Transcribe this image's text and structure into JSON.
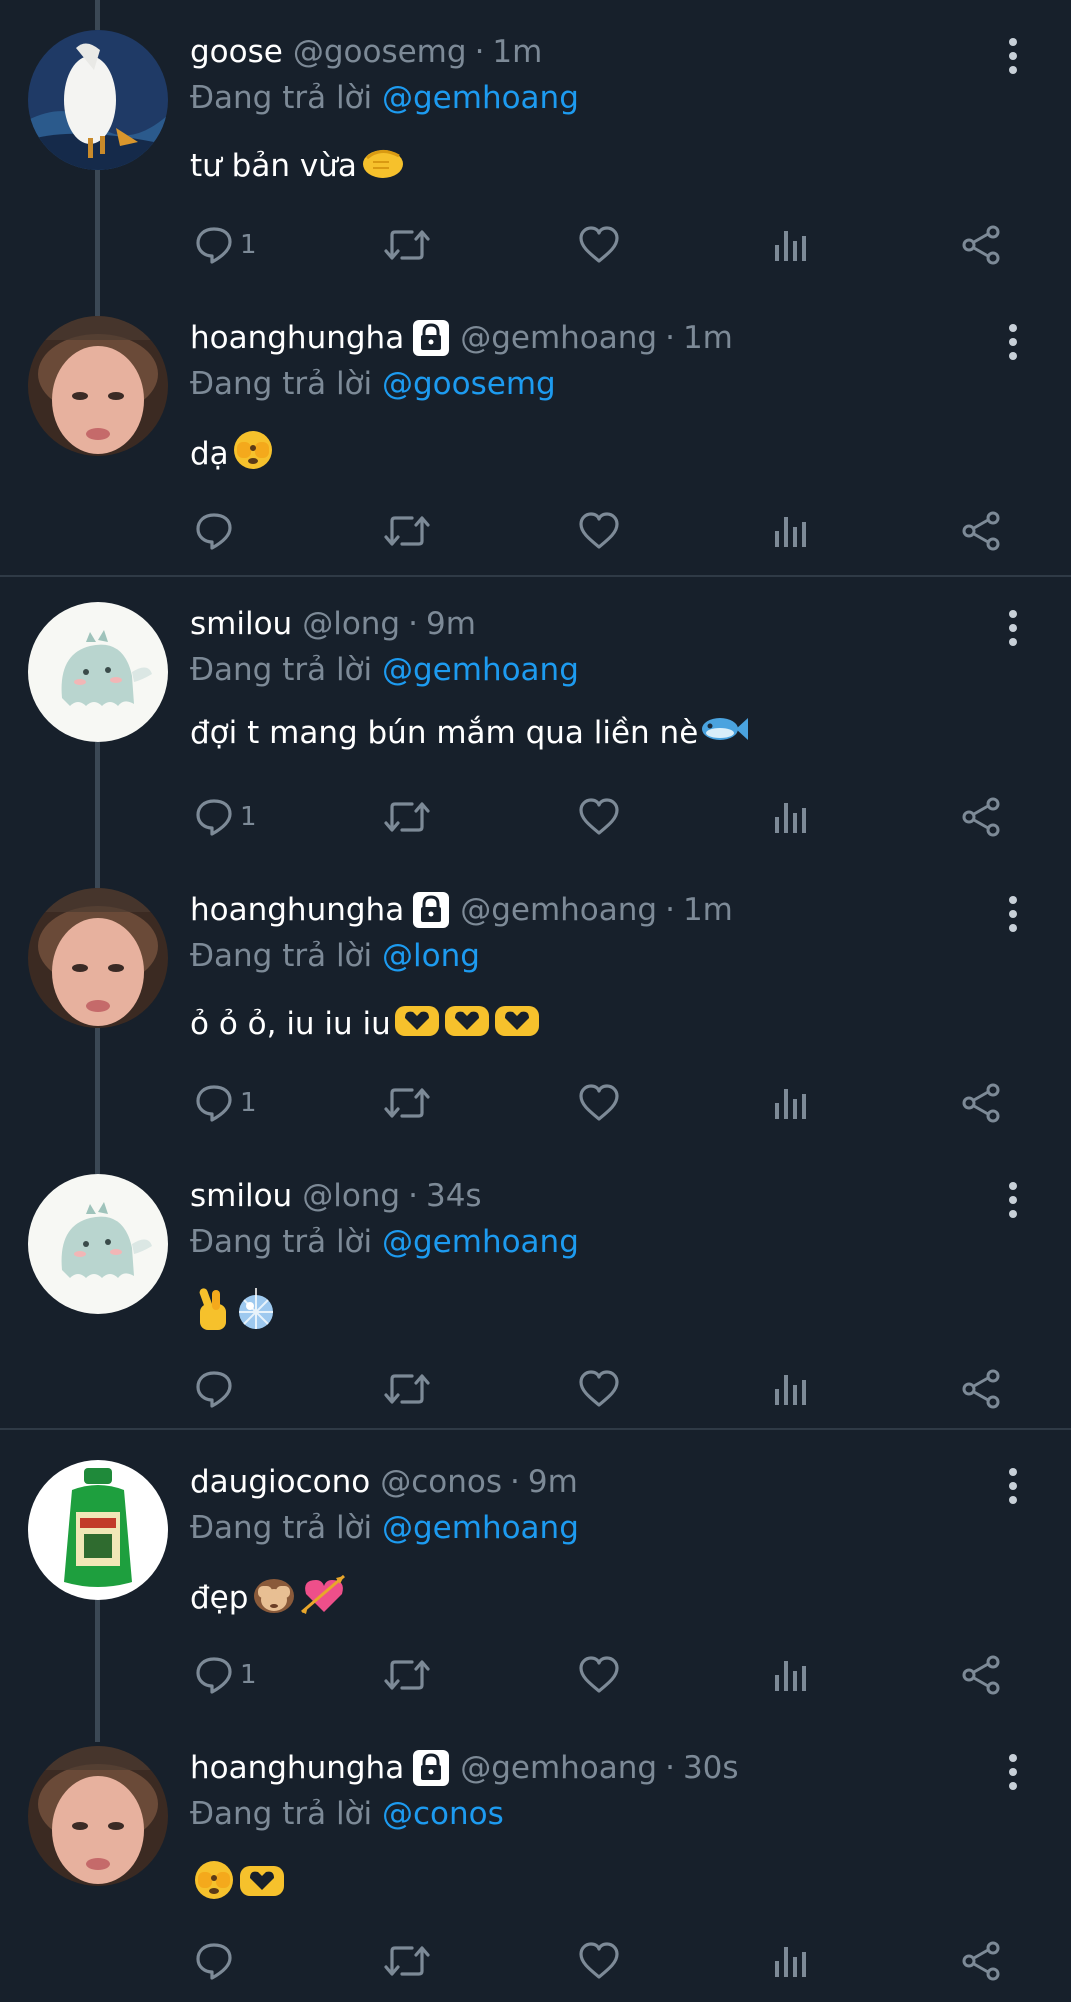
{
  "reply_prefix": "Đang trả lời",
  "colors": {
    "background": "#17202b",
    "muted": "#7d8a97",
    "mention": "#1d9bf0",
    "divider": "#2f3a46"
  },
  "tweets": [
    {
      "name": "goose",
      "handle": "@goosemg",
      "time": "1m",
      "reply_to": "@gemhoang",
      "text": "tư bản vừa",
      "emojis": [
        "👊"
      ],
      "replies": "1",
      "avatar": "goose-photo",
      "locked": false
    },
    {
      "name": "hoanghungha",
      "handle": "@gemhoang",
      "time": "1m",
      "reply_to": "@goosemg",
      "text": "dạ",
      "emojis": [
        "🫣"
      ],
      "replies": "",
      "avatar": "selfie-photo",
      "locked": true
    },
    {
      "name": "smilou",
      "handle": "@long",
      "time": "9m",
      "reply_to": "@gemhoang",
      "text": "đợi t mang bún mắm qua liền nè",
      "emojis": [
        "🐟"
      ],
      "replies": "1",
      "avatar": "ghost-cartoon",
      "locked": false
    },
    {
      "name": "hoanghungha",
      "handle": "@gemhoang",
      "time": "1m",
      "reply_to": "@long",
      "text": "ỏ ỏ ỏ, iu iu iu",
      "emojis": [
        "🫶",
        "🫶",
        "🫶"
      ],
      "replies": "1",
      "avatar": "selfie-photo",
      "locked": true
    },
    {
      "name": "smilou",
      "handle": "@long",
      "time": "34s",
      "reply_to": "@gemhoang",
      "text": "",
      "emojis": [
        "🫰",
        "🪩"
      ],
      "replies": "",
      "avatar": "ghost-cartoon",
      "locked": false
    },
    {
      "name": "daugiocono",
      "handle": "@conos",
      "time": "9m",
      "reply_to": "@gemhoang",
      "text": "đẹp",
      "emojis": [
        "🙈",
        "💘"
      ],
      "replies": "1",
      "avatar": "oil-bottle-photo",
      "locked": false
    },
    {
      "name": "hoanghungha",
      "handle": "@gemhoang",
      "time": "30s",
      "reply_to": "@conos",
      "text": "",
      "emojis": [
        "🫣",
        "🫶"
      ],
      "replies": "",
      "avatar": "selfie-photo",
      "locked": true
    }
  ],
  "icons": [
    "reply-icon",
    "retweet-icon",
    "like-icon",
    "views-icon",
    "share-icon",
    "more-icon",
    "lock-icon"
  ]
}
